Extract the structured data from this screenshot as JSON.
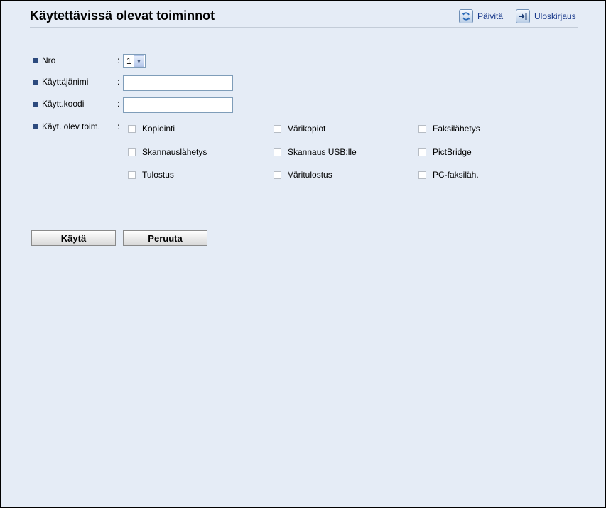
{
  "header": {
    "title": "Käytettävissä olevat toiminnot",
    "refresh_label": "Päivitä",
    "logout_label": "Uloskirjaus"
  },
  "form": {
    "colon": ":",
    "nro": {
      "label": "Nro",
      "value": "1"
    },
    "username": {
      "label": "Käyttäjänimi",
      "value": ""
    },
    "usercode": {
      "label": "Käytt.koodi",
      "value": ""
    },
    "functions": {
      "label": "Käyt. olev toim.",
      "options": [
        {
          "label": "Kopiointi",
          "checked": false
        },
        {
          "label": "Värikopiot",
          "checked": false
        },
        {
          "label": "Faksilähetys",
          "checked": false
        },
        {
          "label": "Skannauslähetys",
          "checked": false
        },
        {
          "label": "Skannaus USB:lle",
          "checked": false
        },
        {
          "label": "PictBridge",
          "checked": false
        },
        {
          "label": "Tulostus",
          "checked": false
        },
        {
          "label": "Väritulostus",
          "checked": false
        },
        {
          "label": "PC-faksiläh.",
          "checked": false
        }
      ]
    }
  },
  "buttons": {
    "apply_label": "Käytä",
    "cancel_label": "Peruuta"
  },
  "icons": {
    "refresh": "refresh-icon",
    "logout": "logout-icon",
    "bullet": "square-bullet"
  },
  "colors": {
    "background": "#e5ecf6",
    "link": "#1a3a8c",
    "bullet": "#2c4a7e"
  }
}
